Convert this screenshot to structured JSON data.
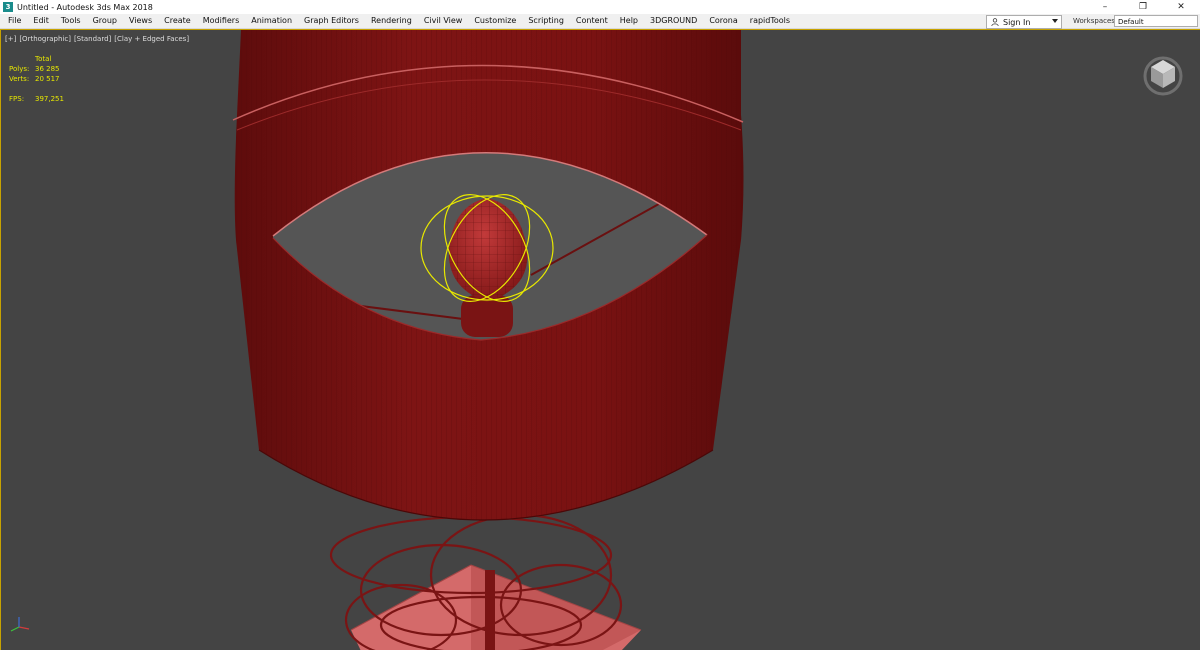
{
  "window": {
    "title": "Untitled - Autodesk 3ds Max 2018",
    "minimize": "–",
    "restore": "❐",
    "close": "✕"
  },
  "menu": {
    "items": [
      "File",
      "Edit",
      "Tools",
      "Group",
      "Views",
      "Create",
      "Modifiers",
      "Animation",
      "Graph Editors",
      "Rendering",
      "Civil View",
      "Customize",
      "Scripting",
      "Content",
      "Help",
      "3DGROUND",
      "Corona",
      "rapidTools"
    ]
  },
  "account": {
    "signin_label": "Sign In",
    "workspaces_label": "Workspaces:",
    "workspaces_value": "Default"
  },
  "viewport": {
    "labels": [
      "[+]",
      "[Orthographic]",
      "[Standard]",
      "[Clay + Edged Faces]"
    ],
    "stats": {
      "total_label": "Total",
      "polys_label": "Polys:",
      "polys_value": "36 285",
      "verts_label": "Verts:",
      "verts_value": "20 517",
      "fps_label": "FPS:",
      "fps_value": "397,251"
    }
  },
  "colors": {
    "viewport_bg": "#444444",
    "shade_red": "#7a1010",
    "selection_yellow": "#e8e800",
    "base_pink": "#d46a6a"
  },
  "icons": {
    "app": "3ds-max-icon",
    "user": "user-icon",
    "viewcube": "viewcube-icon",
    "tripod": "axis-tripod-icon"
  }
}
